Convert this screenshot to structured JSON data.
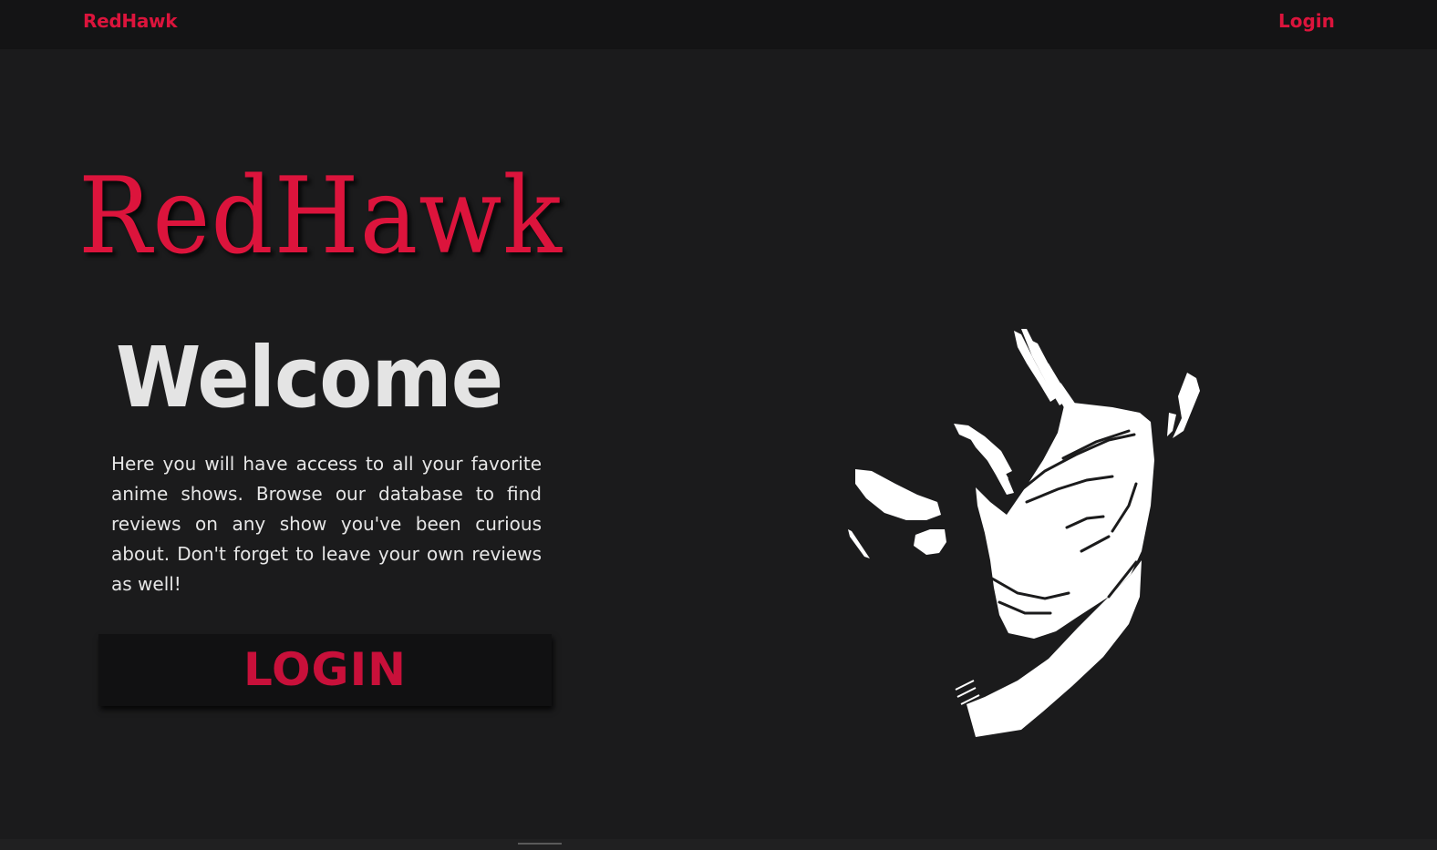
{
  "navbar": {
    "brand": "RedHawk",
    "login_link": "Login"
  },
  "hero": {
    "logo_text": "RedHawk",
    "heading": "Welcome",
    "description": "Here you will have access to all your favorite anime shows. Browse our database to find reviews on any show you've been curious about. Don't forget to leave your own reviews as well!",
    "login_button": "LOGIN"
  },
  "illustration": {
    "icon": "anime-character-silhouette"
  },
  "colors": {
    "accent": "#dc143c",
    "background": "#1b1b1c",
    "navbar": "#141415",
    "heading": "#e4e4e4"
  }
}
